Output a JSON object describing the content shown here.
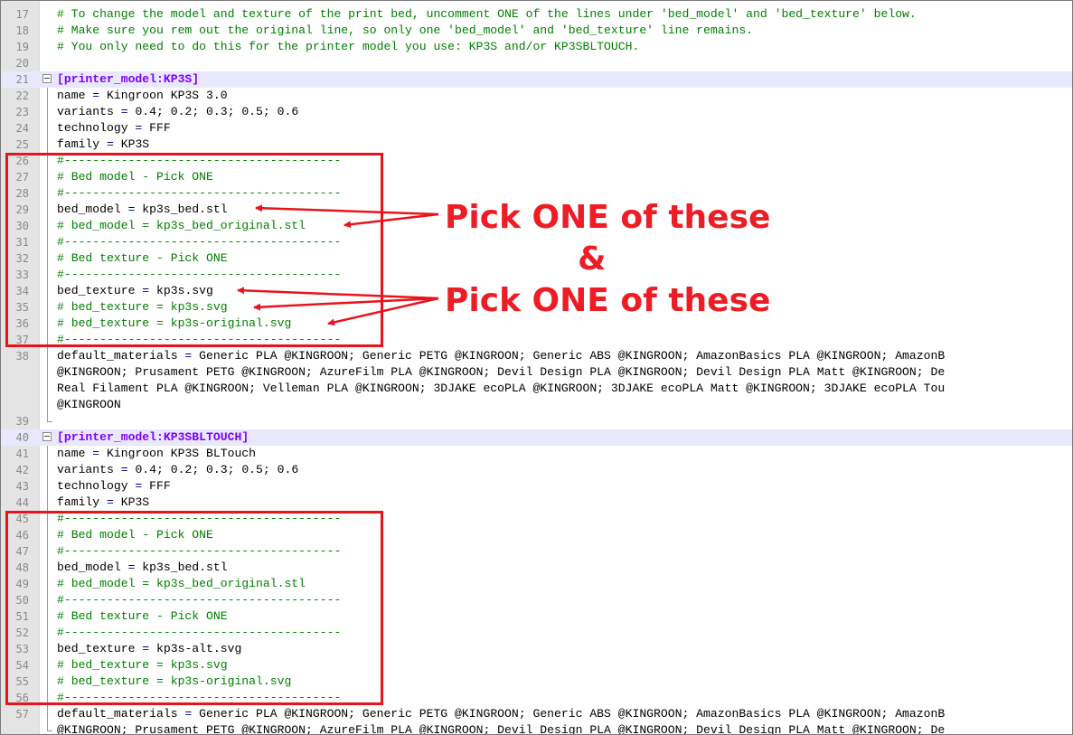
{
  "editor": {
    "lines": [
      {
        "n": "17",
        "kind": "comment",
        "text": "# To change the model and texture of the print bed, uncomment ONE of the lines under 'bed_model' and 'bed_texture' below."
      },
      {
        "n": "18",
        "kind": "comment",
        "text": "# Make sure you rem out the original line, so only one 'bed_model' and 'bed_texture' line remains."
      },
      {
        "n": "19",
        "kind": "comment",
        "text": "# You only need to do this for the printer model you use: KP3S and/or KP3SBLTOUCH."
      },
      {
        "n": "20",
        "kind": "blank",
        "text": ""
      },
      {
        "n": "21",
        "kind": "section",
        "text": "[printer_model:KP3S]"
      },
      {
        "n": "22",
        "kind": "kv",
        "key": "name",
        "value": "Kingroon KP3S 3.0"
      },
      {
        "n": "23",
        "kind": "kv",
        "key": "variants",
        "value": "0.4; 0.2; 0.3; 0.5; 0.6"
      },
      {
        "n": "24",
        "kind": "kv",
        "key": "technology",
        "value": "FFF"
      },
      {
        "n": "25",
        "kind": "kv",
        "key": "family",
        "value": "KP3S"
      },
      {
        "n": "26",
        "kind": "comment",
        "text": "#---------------------------------------"
      },
      {
        "n": "27",
        "kind": "comment",
        "text": "# Bed model - Pick ONE"
      },
      {
        "n": "28",
        "kind": "comment",
        "text": "#---------------------------------------"
      },
      {
        "n": "29",
        "kind": "kv",
        "key": "bed_model",
        "value": "kp3s_bed.stl"
      },
      {
        "n": "30",
        "kind": "comment",
        "text": "# bed_model = kp3s_bed_original.stl"
      },
      {
        "n": "31",
        "kind": "comment",
        "text": "#---------------------------------------"
      },
      {
        "n": "32",
        "kind": "comment",
        "text": "# Bed texture - Pick ONE"
      },
      {
        "n": "33",
        "kind": "comment",
        "text": "#---------------------------------------"
      },
      {
        "n": "34",
        "kind": "kv",
        "key": "bed_texture",
        "value": "kp3s.svg"
      },
      {
        "n": "35",
        "kind": "comment",
        "text": "# bed_texture = kp3s.svg"
      },
      {
        "n": "36",
        "kind": "comment",
        "text": "# bed_texture = kp3s-original.svg"
      },
      {
        "n": "37",
        "kind": "comment",
        "text": "#---------------------------------------"
      },
      {
        "n": "38",
        "kind": "kv",
        "key": "default_materials",
        "value": "Generic PLA @KINGROON; Generic PETG @KINGROON; Generic ABS @KINGROON; AmazonBasics PLA @KINGROON; AmazonB"
      },
      {
        "n": "",
        "kind": "wrap",
        "text": "@KINGROON; Prusament PETG @KINGROON; AzureFilm PLA @KINGROON; Devil Design PLA @KINGROON; Devil Design PLA Matt @KINGROON; De"
      },
      {
        "n": "",
        "kind": "wrap",
        "text": "Real Filament PLA @KINGROON; Velleman PLA @KINGROON; 3DJAKE ecoPLA @KINGROON; 3DJAKE ecoPLA Matt @KINGROON; 3DJAKE ecoPLA Tou"
      },
      {
        "n": "",
        "kind": "wrap",
        "text": "@KINGROON"
      },
      {
        "n": "39",
        "kind": "blank",
        "text": ""
      },
      {
        "n": "40",
        "kind": "section",
        "text": "[printer_model:KP3SBLTOUCH]"
      },
      {
        "n": "41",
        "kind": "kv",
        "key": "name",
        "value": "Kingroon KP3S BLTouch"
      },
      {
        "n": "42",
        "kind": "kv",
        "key": "variants",
        "value": "0.4; 0.2; 0.3; 0.5; 0.6"
      },
      {
        "n": "43",
        "kind": "kv",
        "key": "technology",
        "value": "FFF"
      },
      {
        "n": "44",
        "kind": "kv",
        "key": "family",
        "value": "KP3S"
      },
      {
        "n": "45",
        "kind": "comment",
        "text": "#---------------------------------------"
      },
      {
        "n": "46",
        "kind": "comment",
        "text": "# Bed model - Pick ONE"
      },
      {
        "n": "47",
        "kind": "comment",
        "text": "#---------------------------------------"
      },
      {
        "n": "48",
        "kind": "kv",
        "key": "bed_model",
        "value": "kp3s_bed.stl"
      },
      {
        "n": "49",
        "kind": "comment",
        "text": "# bed_model = kp3s_bed_original.stl"
      },
      {
        "n": "50",
        "kind": "comment",
        "text": "#---------------------------------------"
      },
      {
        "n": "51",
        "kind": "comment",
        "text": "# Bed texture - Pick ONE"
      },
      {
        "n": "52",
        "kind": "comment",
        "text": "#---------------------------------------"
      },
      {
        "n": "53",
        "kind": "kv",
        "key": "bed_texture",
        "value": "kp3s-alt.svg"
      },
      {
        "n": "54",
        "kind": "comment",
        "text": "# bed_texture = kp3s.svg"
      },
      {
        "n": "55",
        "kind": "comment",
        "text": "# bed_texture = kp3s-original.svg"
      },
      {
        "n": "56",
        "kind": "comment",
        "text": "#---------------------------------------"
      },
      {
        "n": "57",
        "kind": "kv",
        "key": "default_materials",
        "value": "Generic PLA @KINGROON; Generic PETG @KINGROON; Generic ABS @KINGROON; AmazonBasics PLA @KINGROON; AmazonB"
      },
      {
        "n": "",
        "kind": "wrap",
        "text": "@KINGROON; Prusament PETG @KINGROON; AzureFilm PLA @KINGROON; Devil Design PLA @KINGROON; Devil Design PLA Matt @KINGROON; De"
      }
    ]
  },
  "annotations": {
    "callout_model": "Pick ONE of these",
    "ampersand": "&",
    "callout_texture": "Pick ONE of these"
  },
  "colors": {
    "annotation": "#e8141c",
    "comment": "#008000",
    "section": "#8000ff",
    "line_highlight": "#e8e8ff",
    "gutter": "#e4e4e4"
  }
}
